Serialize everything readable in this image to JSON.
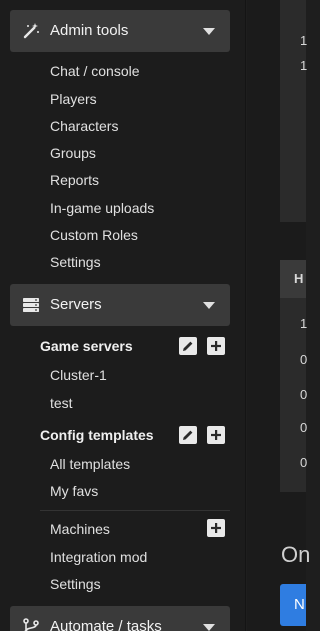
{
  "sidebar": {
    "admin": {
      "title": "Admin tools",
      "icon": "magic-wand-icon",
      "items": [
        "Chat / console",
        "Players",
        "Characters",
        "Groups",
        "Reports",
        "In-game uploads",
        "Custom Roles",
        "Settings"
      ]
    },
    "servers": {
      "title": "Servers",
      "icon": "server-icon",
      "game_servers_label": "Game servers",
      "game_servers": [
        "Cluster-1",
        "test"
      ],
      "config_templates_label": "Config templates",
      "config_templates": [
        "All templates",
        "My favs"
      ],
      "machines_label": "Machines",
      "integration_label": "Integration mod",
      "settings_label": "Settings"
    },
    "automate": {
      "title": "Automate / tasks",
      "icon": "branch-icon"
    }
  },
  "main": {
    "panel1_lines": [
      "1",
      "1"
    ],
    "panel2_header": "H",
    "panel2_lines": [
      "1",
      "0",
      "0",
      "0",
      "0"
    ],
    "heading": "On",
    "button_label": "N"
  },
  "colors": {
    "accent": "#2f7de1",
    "sidebar_header_bg": "#3a3a3a",
    "background": "#1e1e1e"
  }
}
